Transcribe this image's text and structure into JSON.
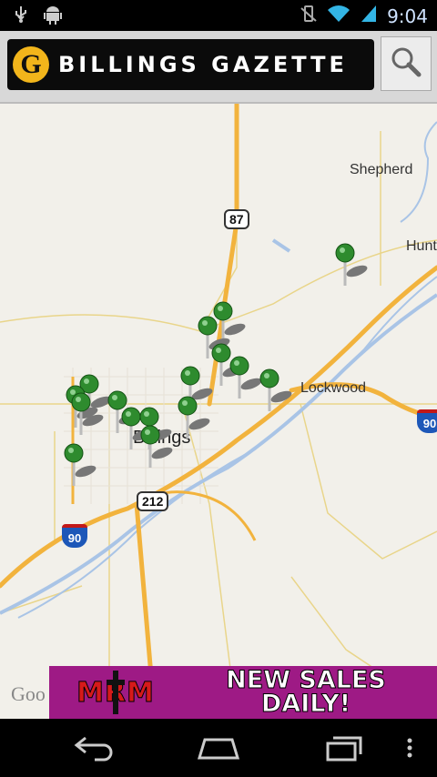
{
  "status_bar": {
    "time": "9:04"
  },
  "header": {
    "logo_letter": "G",
    "title": "BILLINGS GAZETTE"
  },
  "map": {
    "labels": {
      "shepherd": "Shepherd",
      "hunt": "Hunt",
      "lockwood": "Lockwood",
      "billings": "Billings"
    },
    "shields": {
      "us87": "87",
      "us212": "212",
      "i90_left": "90",
      "i90_right": "90"
    },
    "attribution": "Goo"
  },
  "ad": {
    "logo_text": "MRM",
    "headline_line1": "NEW SALES",
    "headline_line2": "DAILY!"
  },
  "colors": {
    "pin": "#2e8b2e",
    "ad_bg": "#9e1a85",
    "road_major": "#f2b33d",
    "river": "#a9c4e6"
  }
}
